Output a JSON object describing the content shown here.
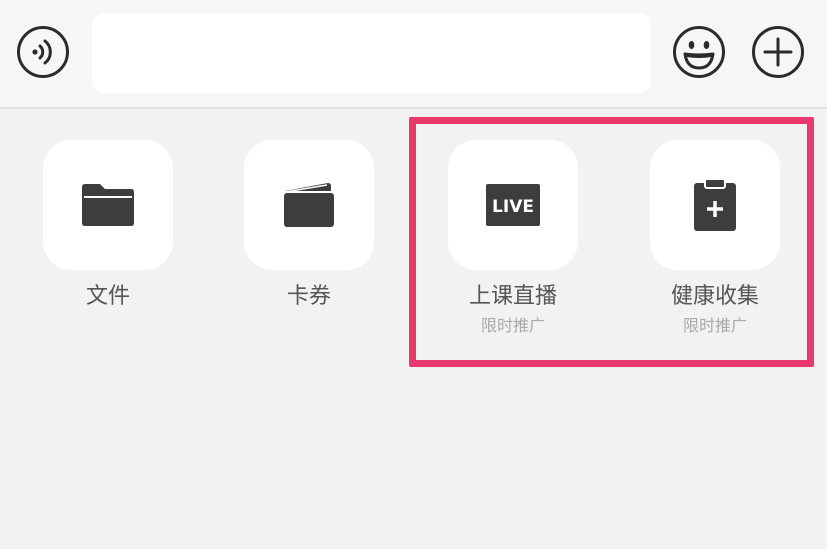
{
  "input_bar": {
    "voice_icon": "voice-icon",
    "input_value": "",
    "input_placeholder": "",
    "emoji_icon": "emoji-smile-icon",
    "plus_icon": "plus-circle-icon"
  },
  "apps": [
    {
      "label": "文件",
      "subtitle": "",
      "icon": "folder-icon"
    },
    {
      "label": "卡券",
      "subtitle": "",
      "icon": "wallet-icon"
    },
    {
      "label": "上课直播",
      "subtitle": "限时推广",
      "icon": "live-icon",
      "icon_text": "LIVE"
    },
    {
      "label": "健康收集",
      "subtitle": "限时推广",
      "icon": "clipboard-plus-icon"
    }
  ],
  "colors": {
    "highlight": "#e8386e",
    "icon": "#3d3d3d",
    "background": "#f2f2f2",
    "tile": "#ffffff"
  }
}
